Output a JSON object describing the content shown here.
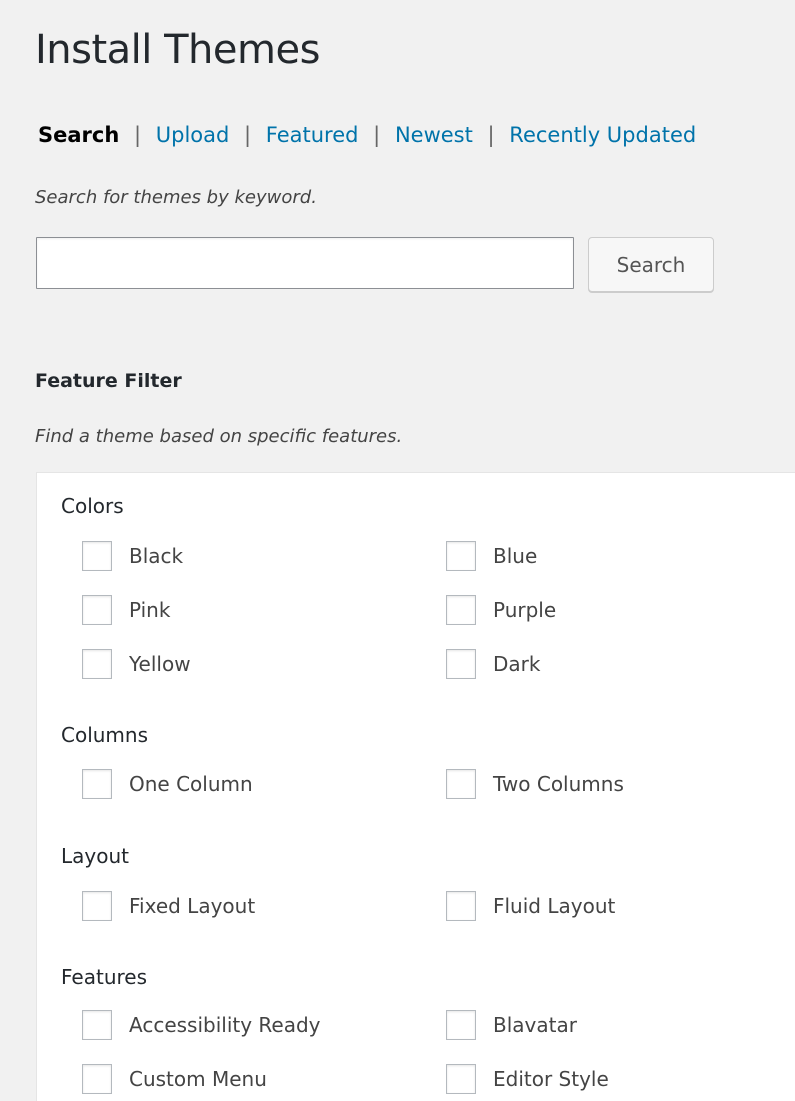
{
  "page": {
    "title": "Install Themes"
  },
  "tabs": {
    "current": "Search",
    "links": [
      "Upload",
      "Featured",
      "Newest",
      "Recently Updated"
    ],
    "separator": "|"
  },
  "search": {
    "hint": "Search for themes by keyword.",
    "input_value": "",
    "placeholder": "",
    "button_label": "Search"
  },
  "filter": {
    "heading": "Feature Filter",
    "hint": "Find a theme based on specific features.",
    "groups": [
      {
        "title": "Colors",
        "options": [
          "Black",
          "Blue",
          "Pink",
          "Purple",
          "Yellow",
          "Dark"
        ]
      },
      {
        "title": "Columns",
        "options": [
          "One Column",
          "Two Columns"
        ]
      },
      {
        "title": "Layout",
        "options": [
          "Fixed Layout",
          "Fluid Layout"
        ]
      },
      {
        "title": "Features",
        "options": [
          "Accessibility Ready",
          "Blavatar",
          "Custom Menu",
          "Editor Style"
        ]
      }
    ]
  },
  "colors": {
    "link": "#0073aa",
    "background": "#f1f1f1",
    "panel": "#ffffff",
    "text": "#444444"
  }
}
